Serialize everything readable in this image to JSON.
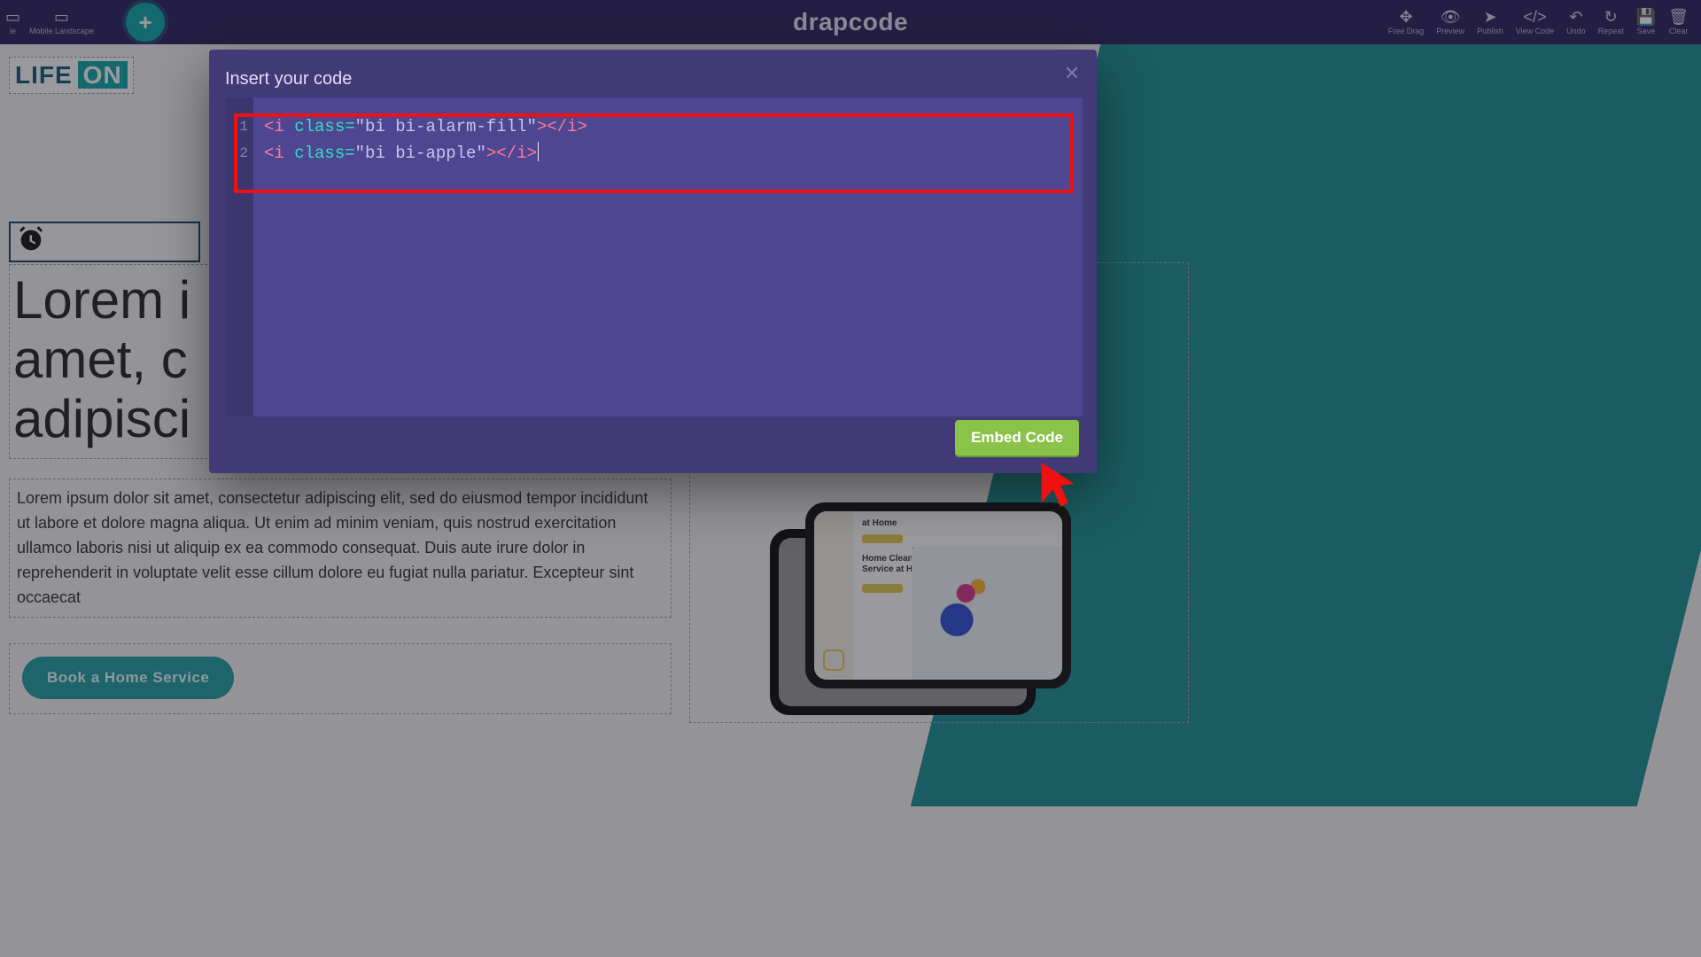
{
  "toolbar": {
    "left": [
      {
        "name": "mobile-icon",
        "label": "le",
        "glyph": "▭"
      },
      {
        "name": "mobile-landscape-icon",
        "label": "Mobile Landscape",
        "glyph": "▭"
      }
    ],
    "add_label": "+",
    "brand": "drapcode",
    "right": [
      {
        "name": "free-drag-icon",
        "label": "Free Drag",
        "glyph": "✥"
      },
      {
        "name": "preview-icon",
        "label": "Preview",
        "glyph": "👁"
      },
      {
        "name": "publish-icon",
        "label": "Publish",
        "glyph": "➤"
      },
      {
        "name": "view-code-icon",
        "label": "View Code",
        "glyph": "</>"
      },
      {
        "name": "undo-icon",
        "label": "Undo",
        "glyph": "↶"
      },
      {
        "name": "repeat-icon",
        "label": "Repeat",
        "glyph": "↻"
      },
      {
        "name": "save-icon",
        "label": "Save",
        "glyph": "💾"
      },
      {
        "name": "clear-icon",
        "label": "Clear",
        "glyph": "🗑"
      }
    ]
  },
  "page": {
    "logo_a": "LIFE",
    "logo_b": "ON",
    "headline": "Lorem i\namet, c\nadipisci",
    "paragraph": "Lorem ipsum dolor sit amet, consectetur adipiscing elit, sed do eiusmod tempor incididunt ut labore et dolore magna aliqua. Ut enim ad minim veniam, quis nostrud exercitation ullamco laboris nisi ut aliquip ex ea commodo consequat. Duis aute irure dolor in reprehenderit in voluptate velit esse cillum dolore eu fugiat nulla pariatur. Excepteur sint occaecat",
    "cta": "Book a Home Service",
    "phone": {
      "line1": "at Home",
      "line2": "Home Cleane\nService at Ho"
    }
  },
  "modal": {
    "title": "Insert your code",
    "close": "✕",
    "embed": "Embed Code",
    "lines": [
      "1",
      "2"
    ],
    "code": {
      "l1_attr": "class=",
      "l1_val": "\"bi bi-alarm-fill\"",
      "l2_attr": "class=",
      "l2_val": "\"bi bi-apple\"",
      "open": "<i ",
      "mid": ">",
      "close": "</i>"
    }
  }
}
